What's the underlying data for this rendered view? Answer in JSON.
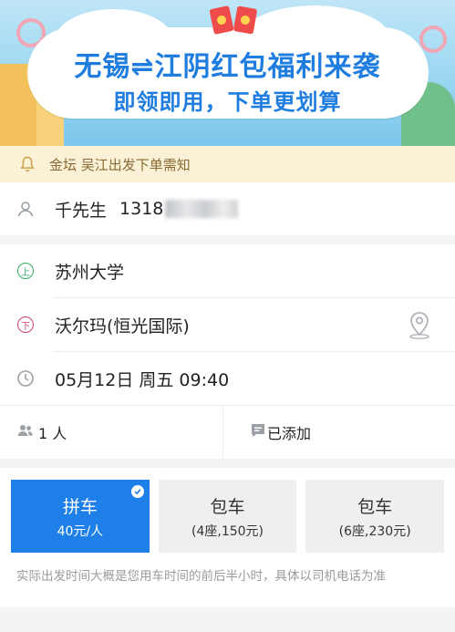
{
  "banner": {
    "title": "无锡⇌江阴红包福利来袭",
    "subtitle": "即领即用，下单更划算"
  },
  "notice": {
    "text": "金坛 吴江出发下单需知"
  },
  "passenger": {
    "name": "千先生",
    "phone_prefix": "1318"
  },
  "route": {
    "pickup": "苏州大学",
    "dropoff": "沃尔玛(恒光国际)",
    "datetime": "05月12日 周五 09:40"
  },
  "people": {
    "count": "1 人",
    "note": "已添加"
  },
  "options": [
    {
      "name": "拼车",
      "price": "40元/人",
      "selected": true
    },
    {
      "name": "包车",
      "price": "(4座,150元)",
      "selected": false
    },
    {
      "name": "包车",
      "price": "(6座,230元)",
      "selected": false
    }
  ],
  "tip": "实际出发时间大概是您用车时间的前后半小时，具体以司机电话为准",
  "colors": {
    "accent": "#1e7fe8",
    "notice_bg": "#fbf1d6",
    "pickup": "#2dae62",
    "dropoff": "#cf3f6e"
  }
}
